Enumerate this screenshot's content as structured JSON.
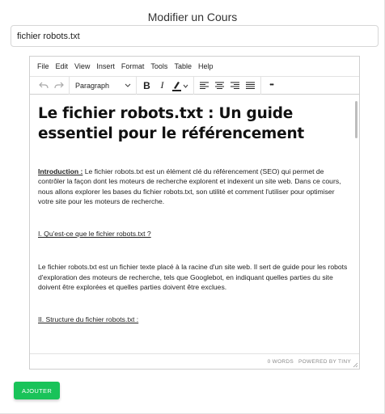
{
  "page": {
    "title": "Modifier un Cours"
  },
  "form": {
    "title_value": "fichier robots.txt",
    "submit_label": "AJOUTER"
  },
  "colors": {
    "accent": "#19c359",
    "border": "#cfcfcf"
  },
  "editor": {
    "menu": [
      "File",
      "Edit",
      "View",
      "Insert",
      "Format",
      "Tools",
      "Table",
      "Help"
    ],
    "toolbar": {
      "block_format": "Paragraph",
      "icons": [
        "undo-icon",
        "redo-icon",
        "bold-icon",
        "italic-icon",
        "highlight-icon",
        "align-left-icon",
        "align-center-icon",
        "align-right-icon",
        "justify-icon",
        "more-icon"
      ],
      "bold_glyph": "B",
      "italic_glyph": "I",
      "more_glyph": "•••"
    },
    "content": {
      "heading": "Le fichier robots.txt : Un guide essentiel pour le référencement",
      "intro_label": "Introduction :",
      "intro_text": " Le fichier robots.txt est un élément clé du référencement (SEO) qui permet de contrôler la façon dont les moteurs de recherche explorent et indexent un site web. Dans ce cours, nous allons explorer les bases du fichier robots.txt, son utilité et comment l'utiliser pour optimiser votre site pour les moteurs de recherche.",
      "section1_title": "I. Qu'est-ce que le fichier robots.txt ?",
      "section1_text": "Le fichier robots.txt est un fichier texte placé à la racine d'un site web. Il sert de guide pour les robots d'exploration des moteurs de recherche, tels que Googlebot, en indiquant quelles parties du site doivent être explorées et quelles parties doivent être exclues.",
      "section2_title": "II. Structure du fichier robots.txt :"
    },
    "status": {
      "word_count": "0 WORDS",
      "powered_by": "POWERED BY TINY"
    }
  }
}
